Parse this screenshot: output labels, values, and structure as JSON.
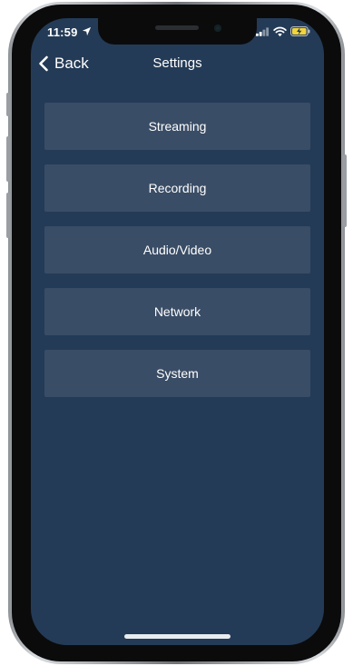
{
  "status_bar": {
    "time": "11:59",
    "icons": [
      "location-arrow-icon",
      "cellular-signal-icon",
      "wifi-icon",
      "battery-charging-icon"
    ]
  },
  "nav": {
    "back_label": "Back",
    "back_icon": "chevron-left-icon",
    "title": "Settings"
  },
  "menu": {
    "items": [
      {
        "label": "Streaming"
      },
      {
        "label": "Recording"
      },
      {
        "label": "Audio/Video"
      },
      {
        "label": "Network"
      },
      {
        "label": "System"
      }
    ]
  },
  "colors": {
    "background": "#243b57",
    "menu_item": "#3a4d66",
    "text": "#ffffff",
    "battery_charge": "#f2d43b"
  }
}
